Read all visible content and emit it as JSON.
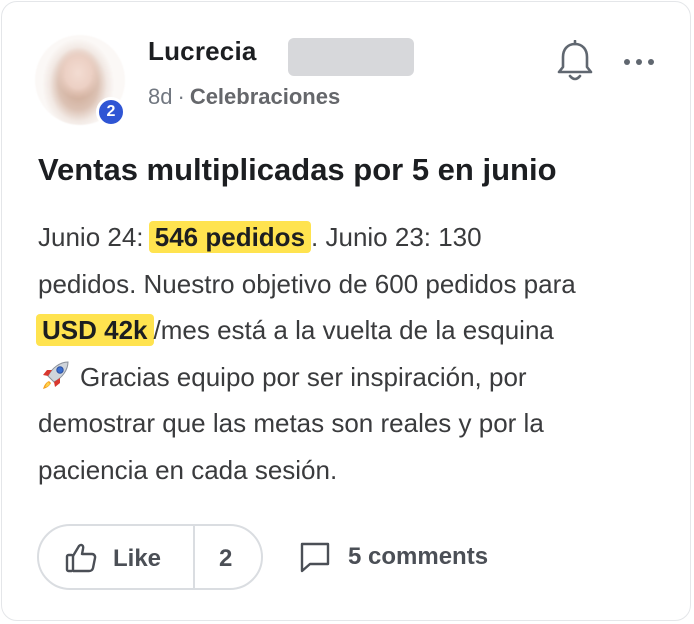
{
  "post": {
    "author": {
      "name": "Lucrecia",
      "badge_count": "2"
    },
    "meta": {
      "time": "8d",
      "separator": "·",
      "category": "Celebraciones"
    },
    "title": "Ventas multiplicadas por 5 en junio",
    "body": {
      "line1_pre": "Junio 24: ",
      "line1_highlight": "546 pedidos",
      "line1_post": ". Junio 23: 130",
      "line2": "pedidos. Nuestro objetivo de 600 pedidos para",
      "line3_highlight": "USD 42k",
      "line3_post": "/mes está a la vuelta de la esquina",
      "line4": "Gracias equipo por ser inspiración, por",
      "line5": "demostrar que las metas son reales y por la",
      "line6": "paciencia en cada sesión."
    },
    "icons": {
      "bell": "bell-icon",
      "more": "more-icon",
      "rocket": "rocket-icon",
      "like": "thumbs-up-icon",
      "comment": "comment-icon"
    },
    "colors": {
      "highlight": "#ffe34f",
      "badge": "#2f55d4",
      "text": "#1c1e21",
      "muted": "#717780"
    }
  },
  "actions": {
    "like_label": "Like",
    "like_count": "2",
    "comments_label": "5 comments"
  }
}
